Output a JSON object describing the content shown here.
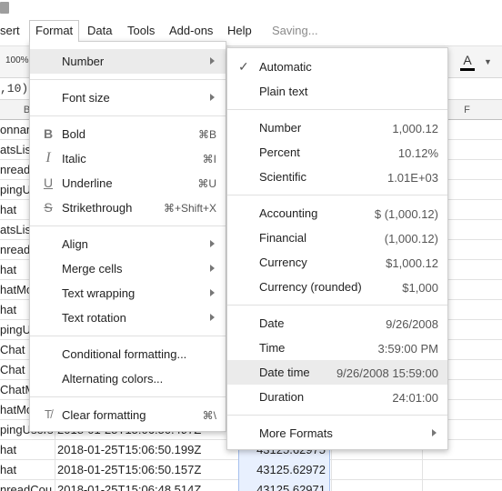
{
  "menubar": {
    "items": [
      "sert",
      "Format",
      "Data",
      "Tools",
      "Add-ons",
      "Help"
    ],
    "status": "Saving..."
  },
  "toolbar": {
    "zoom": "100%",
    "text_color_label": "A"
  },
  "formula": {
    "text": ",10))"
  },
  "grid": {
    "columns": [
      "B",
      "F"
    ],
    "rows": [
      {
        "a": "onnan",
        "b": "",
        "c": ""
      },
      {
        "a": "atsLis",
        "b": "",
        "c": ""
      },
      {
        "a": "nread",
        "b": "",
        "c": ""
      },
      {
        "a": "pingU",
        "b": "",
        "c": ""
      },
      {
        "a": "hat",
        "b": "",
        "c": ""
      },
      {
        "a": "atsLis",
        "b": "",
        "c": ""
      },
      {
        "a": "nread",
        "b": "",
        "c": ""
      },
      {
        "a": "hat",
        "b": "",
        "c": ""
      },
      {
        "a": "hatMo",
        "b": "",
        "c": ""
      },
      {
        "a": "hat",
        "b": "",
        "c": ""
      },
      {
        "a": "pingU",
        "b": "",
        "c": ""
      },
      {
        "a": "Chat",
        "b": "",
        "c": ""
      },
      {
        "a": "Chat",
        "b": "",
        "c": ""
      },
      {
        "a": "ChatM",
        "b": "",
        "c": ""
      },
      {
        "a": "hatMo",
        "b": "",
        "c": ""
      },
      {
        "a": "pingUsers",
        "b": "2018-01-25T15:06:50.497Z",
        "c": ""
      },
      {
        "a": "hat",
        "b": "2018-01-25T15:06:50.199Z",
        "c": "43125.62975"
      },
      {
        "a": "hat",
        "b": "2018-01-25T15:06:50.157Z",
        "c": "43125.62972"
      },
      {
        "a": "nreadCou",
        "b": "2018-01-25T15:06:48.514Z",
        "c": "43125.62971"
      }
    ]
  },
  "format_menu": {
    "number": "Number",
    "font_size": "Font size",
    "bold": "Bold",
    "bold_sc": "⌘B",
    "italic": "Italic",
    "italic_sc": "⌘I",
    "underline": "Underline",
    "underline_sc": "⌘U",
    "strikethrough": "Strikethrough",
    "strikethrough_sc": "⌘+Shift+X",
    "align": "Align",
    "merge_cells": "Merge cells",
    "text_wrapping": "Text wrapping",
    "text_rotation": "Text rotation",
    "conditional_formatting": "Conditional formatting...",
    "alternating_colors": "Alternating colors...",
    "clear_formatting": "Clear formatting",
    "clear_formatting_sc": "⌘\\"
  },
  "number_menu": {
    "automatic": "Automatic",
    "plain_text": "Plain text",
    "number": "Number",
    "number_ex": "1,000.12",
    "percent": "Percent",
    "percent_ex": "10.12%",
    "scientific": "Scientific",
    "scientific_ex": "1.01E+03",
    "accounting": "Accounting",
    "accounting_ex": "$ (1,000.12)",
    "financial": "Financial",
    "financial_ex": "(1,000.12)",
    "currency": "Currency",
    "currency_ex": "$1,000.12",
    "currency_rounded": "Currency (rounded)",
    "currency_rounded_ex": "$1,000",
    "date": "Date",
    "date_ex": "9/26/2008",
    "time": "Time",
    "time_ex": "3:59:00 PM",
    "date_time": "Date time",
    "date_time_ex": "9/26/2008 15:59:00",
    "duration": "Duration",
    "duration_ex": "24:01:00",
    "more_formats": "More Formats"
  }
}
